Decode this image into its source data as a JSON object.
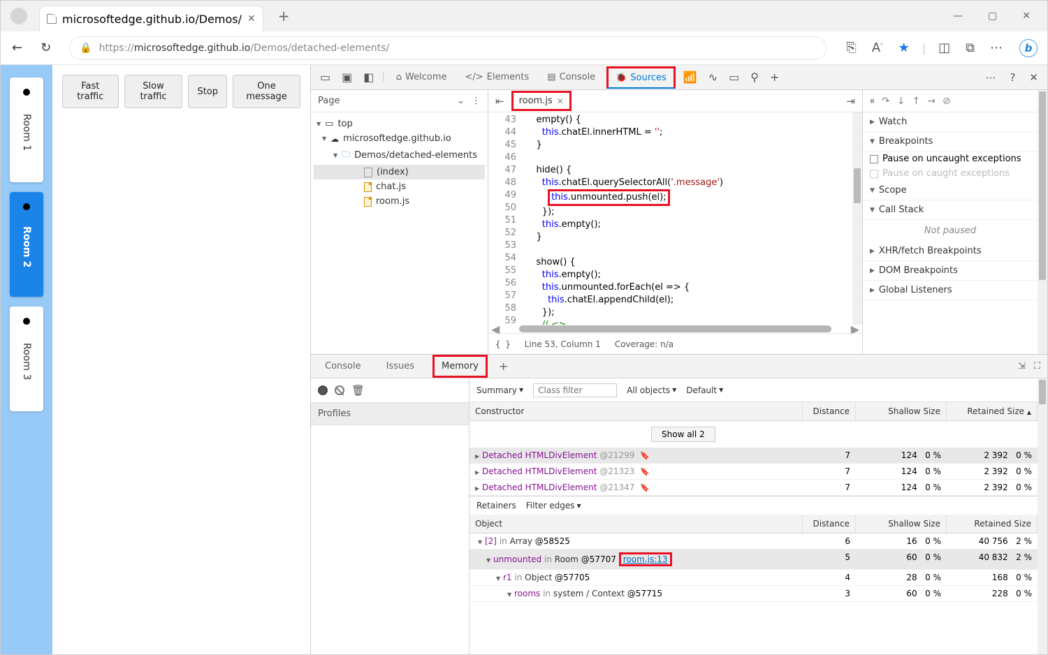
{
  "browser": {
    "tab_title": "microsoftedge.github.io/Demos/",
    "url_prefix": "https://",
    "url_host": "microsoftedge.github.io",
    "url_path": "/Demos/detached-elements/"
  },
  "page": {
    "rooms": [
      "Room 1",
      "Room 2",
      "Room 3"
    ],
    "active_room_index": 1,
    "buttons": {
      "fast": "Fast traffic",
      "slow": "Slow traffic",
      "stop": "Stop",
      "one": "One message"
    }
  },
  "devtools": {
    "tabs": {
      "welcome": "Welcome",
      "elements": "Elements",
      "console": "Console",
      "sources": "Sources"
    },
    "sources": {
      "left_tab": "Page",
      "tree": {
        "top": "top",
        "host": "microsoftedge.github.io",
        "folder": "Demos/detached-elements",
        "files": [
          "(index)",
          "chat.js",
          "room.js"
        ]
      },
      "open_file": "room.js",
      "code_lines": [
        {
          "n": 43,
          "t": "    empty() {"
        },
        {
          "n": 44,
          "t": "      this.chatEl.innerHTML = '';"
        },
        {
          "n": 45,
          "t": "    }"
        },
        {
          "n": 46,
          "t": ""
        },
        {
          "n": 47,
          "t": "    hide() {"
        },
        {
          "n": 48,
          "t": "      this.chatEl.querySelectorAll('.message')"
        },
        {
          "n": 49,
          "t": "        this.unmounted.push(el);",
          "highlight": true
        },
        {
          "n": 50,
          "t": "      });"
        },
        {
          "n": 51,
          "t": "      this.empty();"
        },
        {
          "n": 52,
          "t": "    }"
        },
        {
          "n": 53,
          "t": ""
        },
        {
          "n": 54,
          "t": "    show() {"
        },
        {
          "n": 55,
          "t": "      this.empty();"
        },
        {
          "n": 56,
          "t": "      this.unmounted.forEach(el => {"
        },
        {
          "n": 57,
          "t": "        this.chatEl.appendChild(el);"
        },
        {
          "n": 58,
          "t": "      });"
        },
        {
          "n": 59,
          "t": "      // <<LEAK>>"
        }
      ],
      "status": {
        "pos": "Line 53, Column 1",
        "coverage": "Coverage: n/a"
      },
      "debug": {
        "watch": "Watch",
        "breakpoints": "Breakpoints",
        "bp_pause_uncaught": "Pause on uncaught exceptions",
        "bp_pause_caught": "Pause on caught exceptions",
        "scope": "Scope",
        "callstack": "Call Stack",
        "not_paused": "Not paused",
        "xhr": "XHR/fetch Breakpoints",
        "dom": "DOM Breakpoints",
        "listeners": "Global Listeners"
      }
    },
    "drawer": {
      "tabs": {
        "console": "Console",
        "issues": "Issues",
        "memory": "Memory"
      },
      "profiles": "Profiles",
      "summary": "Summary",
      "class_filter_placeholder": "Class filter",
      "all_objects": "All objects",
      "default": "Default",
      "headers": {
        "constructor": "Constructor",
        "distance": "Distance",
        "shallow": "Shallow Size",
        "retained": "Retained Size"
      },
      "show_all": "Show all 2",
      "snapshot_rows": [
        {
          "label": "Detached HTMLDivElement",
          "id": "@21299",
          "dist": "7",
          "shallow": "124",
          "shallow_pct": "0 %",
          "retained": "2 392",
          "retained_pct": "0 %",
          "selected": true
        },
        {
          "label": "Detached HTMLDivElement",
          "id": "@21323",
          "dist": "7",
          "shallow": "124",
          "shallow_pct": "0 %",
          "retained": "2 392",
          "retained_pct": "0 %"
        },
        {
          "label": "Detached HTMLDivElement",
          "id": "@21347",
          "dist": "7",
          "shallow": "124",
          "shallow_pct": "0 %",
          "retained": "2 392",
          "retained_pct": "0 %"
        }
      ],
      "retainers_label": "Retainers",
      "filter_edges": "Filter edges",
      "ret_headers": {
        "object": "Object",
        "distance": "Distance",
        "shallow": "Shallow Size",
        "retained": "Retained Size"
      },
      "retainer_rows": [
        {
          "idx": "[2]",
          "in": "in",
          "type": "Array",
          "id": "@58525",
          "dist": "6",
          "shallow": "16",
          "shallow_pct": "0 %",
          "retained": "40 756",
          "retained_pct": "2 %"
        },
        {
          "idx": "unmounted",
          "in": "in",
          "type": "Room",
          "id": "@57707",
          "link": "room.js:13",
          "dist": "5",
          "shallow": "60",
          "shallow_pct": "0 %",
          "retained": "40 832",
          "retained_pct": "2 %",
          "selected": true
        },
        {
          "idx": "r1",
          "in": "in",
          "type": "Object",
          "id": "@57705",
          "dist": "4",
          "shallow": "28",
          "shallow_pct": "0 %",
          "retained": "168",
          "retained_pct": "0 %"
        },
        {
          "idx": "rooms",
          "in": "in",
          "type": "system / Context",
          "id": "@57715",
          "dist": "3",
          "shallow": "60",
          "shallow_pct": "0 %",
          "retained": "228",
          "retained_pct": "0 %"
        }
      ]
    }
  }
}
